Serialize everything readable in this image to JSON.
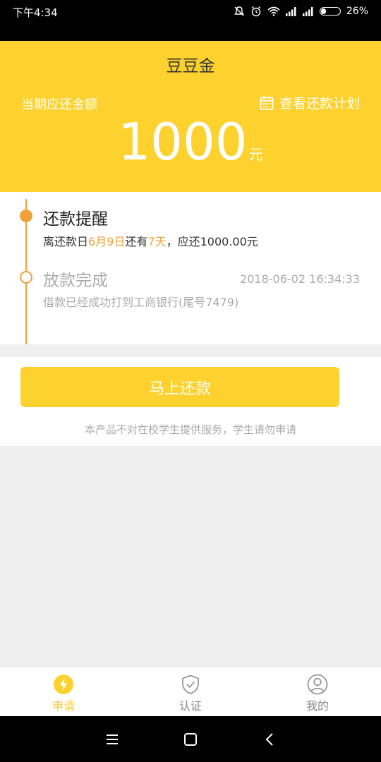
{
  "status_bar": {
    "time": "下午4:34",
    "battery": "26%",
    "battery_level": 0.26
  },
  "header": {
    "title": "豆豆金",
    "amount_label": "当期应还金额",
    "plan_link": "查看还款计划",
    "amount": "1000",
    "amount_unit": "元"
  },
  "timeline": {
    "reminder": {
      "title": "还款提醒",
      "desc_prefix": "离还款日",
      "due_date": "6月9日",
      "desc_mid": "还有",
      "days_left": "7天",
      "desc_suffix": "，应还1000.00元"
    },
    "loan": {
      "title": "放款完成",
      "time": "2018-06-02 16:34:33",
      "desc": "借款已经成功打到工商银行(尾号7479)"
    }
  },
  "action": {
    "repay_button": "马上还款",
    "notice": "本产品不对在校学生提供服务，学生请勿申请"
  },
  "tabbar": {
    "items": [
      {
        "label": "申请",
        "icon": "lightning-icon",
        "active": true
      },
      {
        "label": "认证",
        "icon": "shield-check-icon",
        "active": false
      },
      {
        "label": "我的",
        "icon": "user-icon",
        "active": false
      }
    ]
  },
  "colors": {
    "brand_yellow": "#fdd12e",
    "accent_orange": "#f0a23a",
    "muted_gray": "#aaaaaa"
  }
}
